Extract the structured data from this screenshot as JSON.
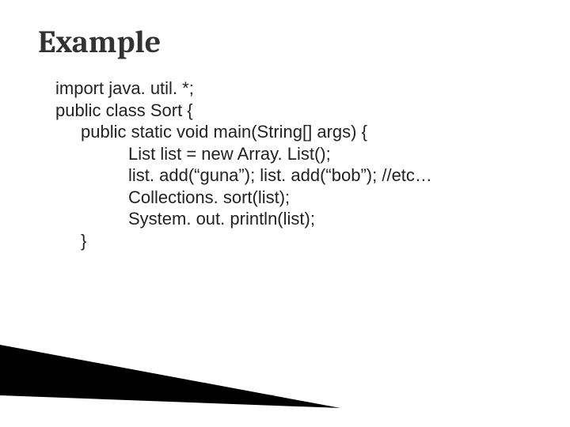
{
  "title": "Example",
  "code": {
    "l1": "import java. util. *;",
    "l2": "public class Sort {",
    "l3": "public static void main(String[] args) {",
    "l4": "List list = new Array. List();",
    "l5": "list. add(“guna”); list. add(“bob”); //etc…",
    "l6": "Collections. sort(list);",
    "l7": "System. out. println(list);",
    "l8": "}"
  }
}
